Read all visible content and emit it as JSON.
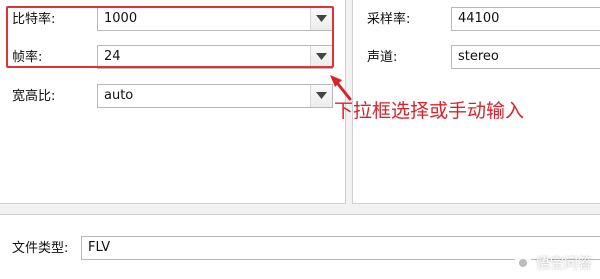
{
  "video": {
    "bitrate": {
      "label": "比特率:",
      "value": "1000"
    },
    "framerate": {
      "label": "帧率:",
      "value": "24"
    },
    "aspect": {
      "label": "宽高比:",
      "value": "auto"
    }
  },
  "audio": {
    "samplerate": {
      "label": "采样率:",
      "value": "44100"
    },
    "channels": {
      "label": "声道:",
      "value": "stereo"
    }
  },
  "file": {
    "type": {
      "label": "文件类型:",
      "value": "FLV"
    }
  },
  "annotation": {
    "text": "下拉框选择或手动输入",
    "color": "#d7242c"
  },
  "watermark": {
    "text": "悟空问答",
    "icon": "wukong-logo-icon"
  },
  "icons": {
    "dropdown": "chevron-down-icon"
  }
}
